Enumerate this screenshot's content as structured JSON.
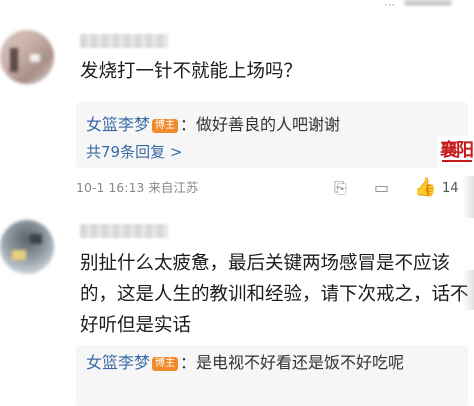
{
  "top": {
    "icon": "more-icon"
  },
  "comments": [
    {
      "text": "发烧打一针不就能上场吗？",
      "reply": {
        "author": "女篮李梦",
        "badge": "博主",
        "separator": "：",
        "text": "做好善良的人吧谢谢"
      },
      "more_replies": "共79条回复 >",
      "time": "10-1 16:13",
      "location": "来自江苏",
      "likes": "14"
    },
    {
      "text": "别扯什么太疲惫，最后关键两场感冒是不应该的，这是人生的教训和经验，请下次戒之，话不好听但是实话",
      "reply": {
        "author": "女篮李梦",
        "badge": "博主",
        "separator": "：",
        "text": "是电视不好看还是饭不好吃呢"
      }
    }
  ],
  "watermark": {
    "text": "襄阳"
  },
  "colors": {
    "link": "#3a6aa6",
    "badge": "#f08a2a",
    "watermark": "#c41a1a"
  }
}
